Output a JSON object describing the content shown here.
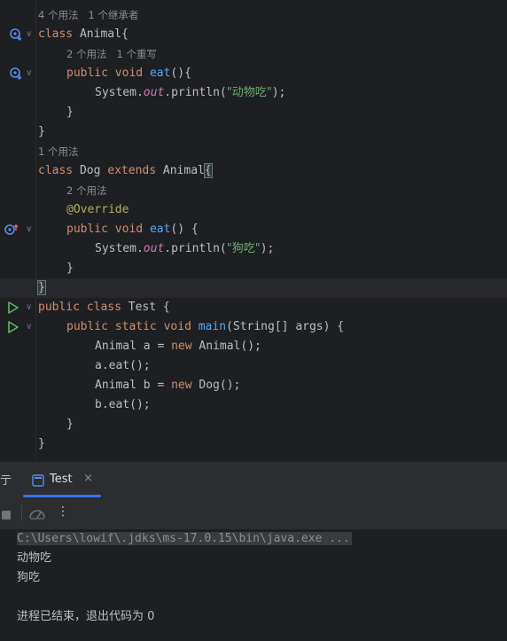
{
  "editor": {
    "hints": {
      "animal_class": "4 个用法   1 个继承者",
      "animal_eat": "2 个用法   1 个重写",
      "dog_class": "1 个用法",
      "dog_eat": "2 个用法"
    },
    "code": {
      "l1_kw": "class ",
      "l1_name": "Animal",
      "l1_brace": "{",
      "l2_kw1": "public ",
      "l2_kw2": "void ",
      "l2_fn": "eat",
      "l2_rest": "(){",
      "l3_sys": "System.",
      "l3_out": "out",
      "l3_mid": ".println(",
      "l3_str": "\"动物吃\"",
      "l3_end": ");",
      "l4": "}",
      "l5": "}",
      "l6_kw": "class ",
      "l6_name": "Dog ",
      "l6_kw2": "extends ",
      "l6_name2": "Animal",
      "l6_brace": "{",
      "l7_ann": "@Override",
      "l8_kw1": "public ",
      "l8_kw2": "void ",
      "l8_fn": "eat",
      "l8_rest": "() {",
      "l9_sys": "System.",
      "l9_out": "out",
      "l9_mid": ".println(",
      "l9_str": "\"狗吃\"",
      "l9_end": ");",
      "l10": "}",
      "l11": "}",
      "l12_kw1": "public ",
      "l12_kw2": "class ",
      "l12_rest": "Test {",
      "l13_kw1": "public ",
      "l13_kw2": "static ",
      "l13_kw3": "void ",
      "l13_fn": "main",
      "l13_rest": "(String[] args) {",
      "l14_a": "Animal a = ",
      "l14_kw": "new ",
      "l14_b": "Animal();",
      "l15": "a.eat();",
      "l16_a": "Animal b = ",
      "l16_kw": "new ",
      "l16_b": "Dog();",
      "l17": "b.eat();",
      "l18": "}",
      "l19": "}"
    }
  },
  "tool_window": {
    "left_tab_label": "亍",
    "tab_label": "Test",
    "close_glyph": "×",
    "console": {
      "command": "C:\\Users\\lowif\\.jdks\\ms-17.0.15\\bin\\java.exe ...",
      "out1": "动物吃",
      "out2": "狗吃",
      "exit": "进程已结束，退出代码为 0"
    }
  },
  "colors": {
    "background": "#1e1f22",
    "keyword": "#cf8e6d",
    "function": "#56a8f5",
    "string": "#6aab73",
    "static_field": "#c77dbb",
    "annotation": "#b3ae60",
    "run_icon": "#5fb865",
    "accent": "#3574f0"
  }
}
